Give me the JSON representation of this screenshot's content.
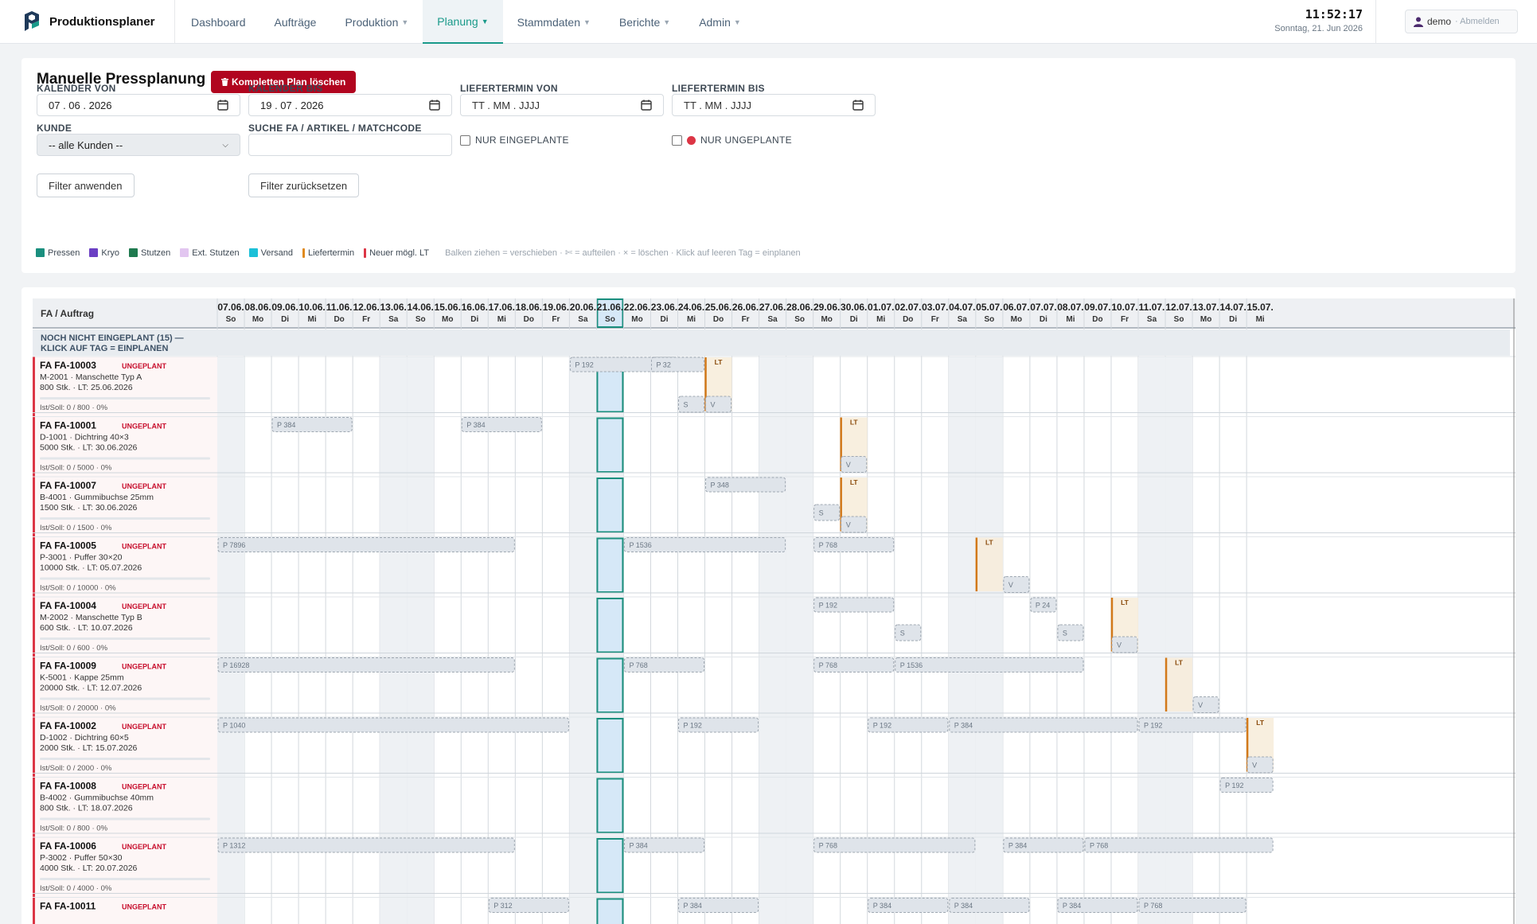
{
  "app": {
    "brand": "Produktionsplaner"
  },
  "nav": [
    {
      "label": "Dashboard",
      "caret": false,
      "active": false
    },
    {
      "label": "Aufträge",
      "caret": false,
      "active": false
    },
    {
      "label": "Produktion",
      "caret": true,
      "active": false
    },
    {
      "label": "Planung",
      "caret": true,
      "active": true
    },
    {
      "label": "Stammdaten",
      "caret": true,
      "active": false
    },
    {
      "label": "Berichte",
      "caret": true,
      "active": false
    },
    {
      "label": "Admin",
      "caret": true,
      "active": false
    }
  ],
  "clock": {
    "time": "11:52:17",
    "date": "Sonntag, 21. Jun 2026"
  },
  "user": {
    "name": "demo",
    "logout": "· Abmelden"
  },
  "page": {
    "title": "Manuelle Pressplanung",
    "delete_button": "Kompletten Plan löschen"
  },
  "filters": {
    "kalender_von": {
      "label": "KALENDER VON",
      "value": "07 . 06 . 2026"
    },
    "kalender_bis": {
      "label": "KALENDER BIS",
      "value": "19 . 07 . 2026"
    },
    "liefertermin_von": {
      "label": "LIEFERTERMIN VON",
      "value": "TT . MM . JJJJ"
    },
    "liefertermin_bis": {
      "label": "LIEFERTERMIN BIS",
      "value": "TT . MM . JJJJ"
    },
    "kunde": {
      "label": "KUNDE",
      "value": "-- alle Kunden --"
    },
    "suche": {
      "label": "SUCHE FA / ARTIKEL / MATCHCODE",
      "value": ""
    },
    "nur_eingeplante": "NUR EINGEPLANTE",
    "nur_ungeplante": "NUR UNGEPLANTE",
    "apply": "Filter anwenden",
    "reset": "Filter zurücksetzen"
  },
  "legend": {
    "items": [
      {
        "label": "Pressen",
        "color": "#1a8f7e"
      },
      {
        "label": "Kryo",
        "color": "#6b3fc4"
      },
      {
        "label": "Stutzen",
        "color": "#1f7a4f"
      },
      {
        "label": "Ext. Stutzen",
        "color": "#e2c6f0"
      },
      {
        "label": "Versand",
        "color": "#1cc0d8"
      },
      {
        "label": "Liefertermin",
        "color": "#e08a1e",
        "bar": true
      },
      {
        "label": "Neuer mögl. LT",
        "color": "#dc3545",
        "bar": true
      }
    ],
    "hints": [
      "Balken ziehen = verschieben",
      "✄ = aufteilen",
      "× = löschen",
      "Klick auf leeren Tag = einplanen"
    ]
  },
  "gantt": {
    "header_label": "FA / Auftrag",
    "today_index": 14,
    "days": [
      {
        "d": "07.06.",
        "w": "So"
      },
      {
        "d": "08.06.",
        "w": "Mo"
      },
      {
        "d": "09.06.",
        "w": "Di"
      },
      {
        "d": "10.06.",
        "w": "Mi"
      },
      {
        "d": "11.06.",
        "w": "Do"
      },
      {
        "d": "12.06.",
        "w": "Fr"
      },
      {
        "d": "13.06.",
        "w": "Sa"
      },
      {
        "d": "14.06.",
        "w": "So"
      },
      {
        "d": "15.06.",
        "w": "Mo"
      },
      {
        "d": "16.06.",
        "w": "Di"
      },
      {
        "d": "17.06.",
        "w": "Mi"
      },
      {
        "d": "18.06.",
        "w": "Do"
      },
      {
        "d": "19.06.",
        "w": "Fr"
      },
      {
        "d": "20.06.",
        "w": "Sa"
      },
      {
        "d": "21.06.",
        "w": "So"
      },
      {
        "d": "22.06.",
        "w": "Mo"
      },
      {
        "d": "23.06.",
        "w": "Di"
      },
      {
        "d": "24.06.",
        "w": "Mi"
      },
      {
        "d": "25.06.",
        "w": "Do"
      },
      {
        "d": "26.06.",
        "w": "Fr"
      },
      {
        "d": "27.06.",
        "w": "Sa"
      },
      {
        "d": "28.06.",
        "w": "So"
      },
      {
        "d": "29.06.",
        "w": "Mo"
      },
      {
        "d": "30.06.",
        "w": "Di"
      },
      {
        "d": "01.07.",
        "w": "Mi"
      },
      {
        "d": "02.07.",
        "w": "Do"
      },
      {
        "d": "03.07.",
        "w": "Fr"
      },
      {
        "d": "04.07.",
        "w": "Sa"
      },
      {
        "d": "05.07.",
        "w": "So"
      },
      {
        "d": "06.07.",
        "w": "Mo"
      },
      {
        "d": "07.07.",
        "w": "Di"
      },
      {
        "d": "08.07.",
        "w": "Mi"
      },
      {
        "d": "09.07.",
        "w": "Do"
      },
      {
        "d": "10.07.",
        "w": "Fr"
      },
      {
        "d": "11.07.",
        "w": "Sa"
      },
      {
        "d": "12.07.",
        "w": "So"
      },
      {
        "d": "13.07.",
        "w": "Mo"
      },
      {
        "d": "14.07.",
        "w": "Di"
      },
      {
        "d": "15.07.",
        "w": "Mi"
      }
    ],
    "group_label_1": "NOCH NICHT EINGEPLANT (15) —",
    "group_label_2": "KLICK AUF TAG = EINPLANEN",
    "status_label": "UNGEPLANT",
    "rows": [
      {
        "fa": "FA FA-10003",
        "article": "M-2001 · Manschette Typ A",
        "qty": "800 Stk. · LT: 25.06.2026",
        "ist": "Ist/Soll: 0 / 800 · 0%",
        "lt": 18,
        "bars": [
          {
            "s": 13,
            "e": 16,
            "label": "P 192"
          },
          {
            "s": 16,
            "e": 17,
            "label": "P 32"
          },
          {
            "s": 17,
            "e": 17,
            "label": "S",
            "row": "low"
          },
          {
            "s": 18,
            "e": 18,
            "label": "V",
            "row": "low"
          }
        ]
      },
      {
        "fa": "FA FA-10001",
        "article": "D-1001 · Dichtring 40×3",
        "qty": "5000 Stk. · LT: 30.06.2026",
        "ist": "Ist/Soll: 0 / 5000 · 0%",
        "lt": 23,
        "bars": [
          {
            "s": 2,
            "e": 4,
            "label": "P 384"
          },
          {
            "s": 9,
            "e": 11,
            "label": "P 384"
          },
          {
            "s": 23,
            "e": 23,
            "label": "V",
            "row": "low"
          }
        ]
      },
      {
        "fa": "FA FA-10007",
        "article": "B-4001 · Gummibuchse 25mm",
        "qty": "1500 Stk. · LT: 30.06.2026",
        "ist": "Ist/Soll: 0 / 1500 · 0%",
        "lt": 23,
        "bars": [
          {
            "s": 18,
            "e": 20,
            "label": "P 348"
          },
          {
            "s": 22,
            "e": 22,
            "label": "S",
            "row": "mid"
          },
          {
            "s": 23,
            "e": 23,
            "label": "V",
            "row": "low"
          }
        ]
      },
      {
        "fa": "FA FA-10005",
        "article": "P-3001 · Puffer 30×20",
        "qty": "10000 Stk. · LT: 05.07.2026",
        "ist": "Ist/Soll: 0 / 10000 · 0%",
        "lt": 28,
        "bars": [
          {
            "s": 0,
            "e": 10,
            "label": "P 7896"
          },
          {
            "s": 15,
            "e": 20,
            "label": "P 1536"
          },
          {
            "s": 22,
            "e": 24,
            "label": "P 768"
          },
          {
            "s": 29,
            "e": 29,
            "label": "V",
            "row": "low"
          }
        ]
      },
      {
        "fa": "FA FA-10004",
        "article": "M-2002 · Manschette Typ B",
        "qty": "600 Stk. · LT: 10.07.2026",
        "ist": "Ist/Soll: 0 / 600 · 0%",
        "lt": 33,
        "bars": [
          {
            "s": 22,
            "e": 24,
            "label": "P 192"
          },
          {
            "s": 30,
            "e": 30,
            "label": "P 24"
          },
          {
            "s": 25,
            "e": 25,
            "label": "S",
            "row": "mid"
          },
          {
            "s": 31,
            "e": 31,
            "label": "S",
            "row": "mid"
          },
          {
            "s": 33,
            "e": 33,
            "label": "V",
            "row": "low"
          }
        ]
      },
      {
        "fa": "FA FA-10009",
        "article": "K-5001 · Kappe 25mm",
        "qty": "20000 Stk. · LT: 12.07.2026",
        "ist": "Ist/Soll: 0 / 20000 · 0%",
        "lt": 35,
        "bars": [
          {
            "s": 0,
            "e": 10,
            "label": "P 16928"
          },
          {
            "s": 15,
            "e": 17,
            "label": "P 768"
          },
          {
            "s": 22,
            "e": 24,
            "label": "P 768"
          },
          {
            "s": 25,
            "e": 31,
            "label": "P 1536"
          },
          {
            "s": 36,
            "e": 36,
            "label": "V",
            "row": "low"
          }
        ]
      },
      {
        "fa": "FA FA-10002",
        "article": "D-1002 · Dichtring 60×5",
        "qty": "2000 Stk. · LT: 15.07.2026",
        "ist": "Ist/Soll: 0 / 2000 · 0%",
        "lt": 38,
        "bars": [
          {
            "s": 0,
            "e": 12,
            "label": "P 1040"
          },
          {
            "s": 17,
            "e": 19,
            "label": "P 192"
          },
          {
            "s": 24,
            "e": 26,
            "label": "P 192"
          },
          {
            "s": 27,
            "e": 33,
            "label": "P 384"
          },
          {
            "s": 34,
            "e": 37,
            "label": "P 192"
          },
          {
            "s": 38,
            "e": 38,
            "label": "V",
            "row": "low"
          }
        ]
      },
      {
        "fa": "FA FA-10008",
        "article": "B-4002 · Gummibuchse 40mm",
        "qty": "800 Stk. · LT: 18.07.2026",
        "ist": "Ist/Soll: 0 / 800 · 0%",
        "lt": -1,
        "bars": [
          {
            "s": 37,
            "e": 38,
            "label": "P 192"
          }
        ]
      },
      {
        "fa": "FA FA-10006",
        "article": "P-3002 · Puffer 50×30",
        "qty": "4000 Stk. · LT: 20.07.2026",
        "ist": "Ist/Soll: 0 / 4000 · 0%",
        "lt": -1,
        "bars": [
          {
            "s": 0,
            "e": 10,
            "label": "P 1312"
          },
          {
            "s": 15,
            "e": 17,
            "label": "P 384"
          },
          {
            "s": 22,
            "e": 27,
            "label": "P 768"
          },
          {
            "s": 29,
            "e": 31,
            "label": "P 384"
          },
          {
            "s": 32,
            "e": 38,
            "label": "P 768"
          }
        ]
      },
      {
        "fa": "FA FA-10011",
        "article": "",
        "qty": "",
        "ist": "",
        "lt": -1,
        "bars": [
          {
            "s": 10,
            "e": 12,
            "label": "P 312"
          },
          {
            "s": 17,
            "e": 19,
            "label": "P 384"
          },
          {
            "s": 24,
            "e": 26,
            "label": "P 384"
          },
          {
            "s": 27,
            "e": 29,
            "label": "P 384"
          },
          {
            "s": 31,
            "e": 33,
            "label": "P 384"
          },
          {
            "s": 34,
            "e": 37,
            "label": "P 768"
          }
        ]
      }
    ]
  }
}
